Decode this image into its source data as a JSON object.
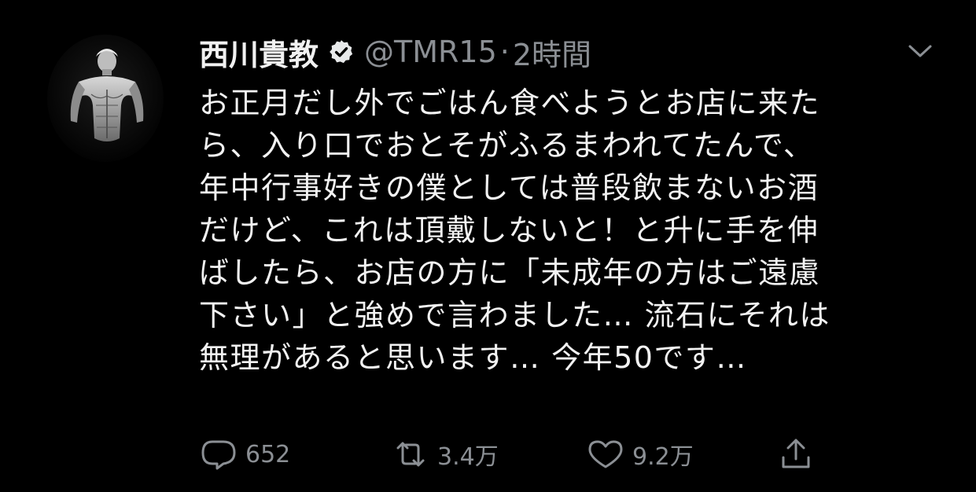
{
  "tweet": {
    "display_name": "西川貴教",
    "handle": "@TMR15",
    "separator": "·",
    "time": "2時間",
    "verified_icon": "verified-badge-icon",
    "lines": [
      "お正月だし外でごはん食べようとお店に来た",
      "ら、入り口でおとそがふるまわれてたんで、",
      "年中行事好きの僕としては普段飲まないお酒",
      "だけど、これは頂戴しないと！と升に手を伸",
      "ばしたら、お店の方に「未成年の方はご遠慮",
      "下さい」と強めで言わました… 流石にそれは",
      "無理があると思います… 今年50です…"
    ]
  },
  "actions": {
    "reply": {
      "icon": "reply-icon",
      "count": "652"
    },
    "retweet": {
      "icon": "retweet-icon",
      "count": "3.4万"
    },
    "like": {
      "icon": "heart-icon",
      "count": "9.2万"
    },
    "share": {
      "icon": "share-icon"
    }
  },
  "menu": {
    "icon": "chevron-down-icon"
  },
  "colors": {
    "background": "#000000",
    "text": "#f2f2f2",
    "muted": "#8b8f94"
  }
}
